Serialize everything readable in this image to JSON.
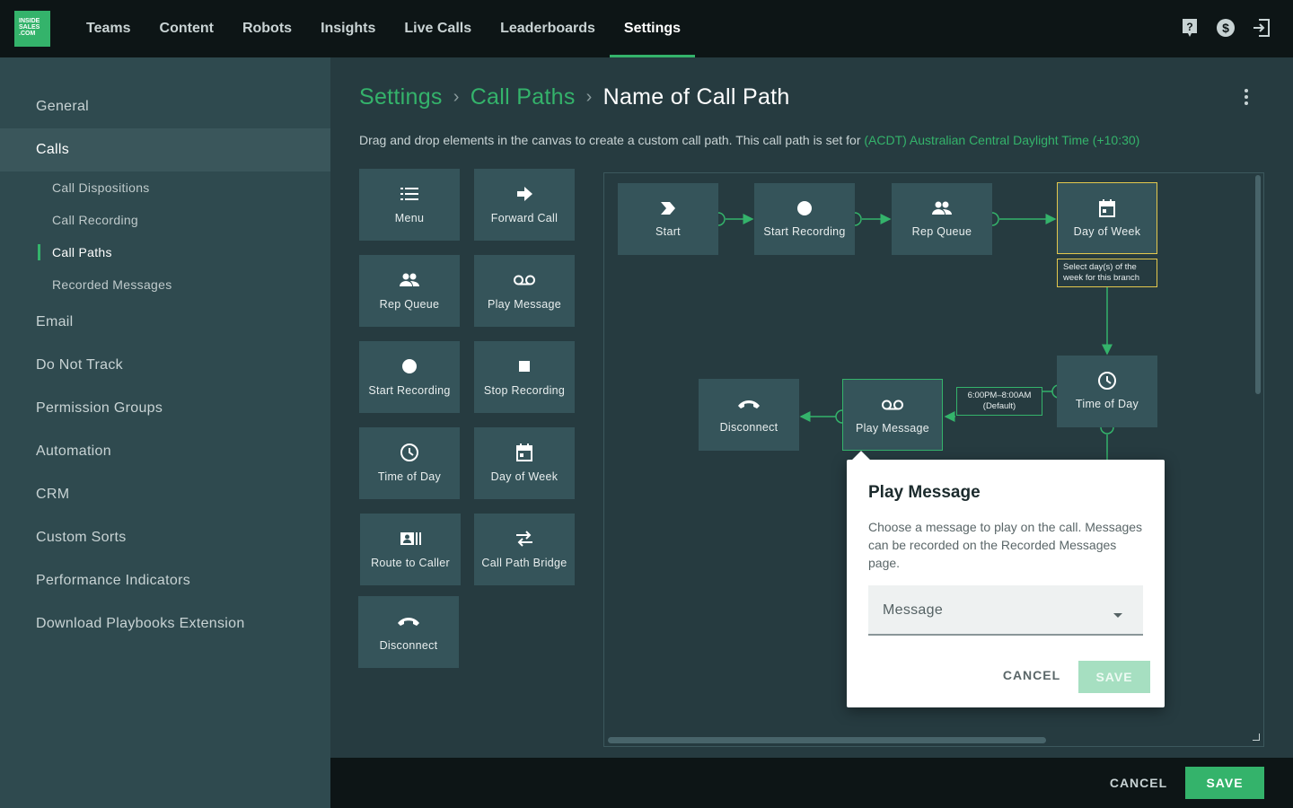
{
  "logo": {
    "line1": "INSIDE",
    "line2": "SALES",
    "line3": ".COM"
  },
  "nav": {
    "items": [
      "Teams",
      "Content",
      "Robots",
      "Insights",
      "Live Calls",
      "Leaderboards",
      "Settings"
    ],
    "active": "Settings"
  },
  "top_icons": [
    "help-icon",
    "dollar-icon",
    "logout-icon"
  ],
  "sidebar": {
    "general": "General",
    "calls": "Calls",
    "calls_sub": [
      "Call Dispositions",
      "Call Recording",
      "Call Paths",
      "Recorded Messages"
    ],
    "others": [
      "Email",
      "Do Not Track",
      "Permission Groups",
      "Automation",
      "CRM",
      "Custom Sorts",
      "Performance Indicators",
      "Download Playbooks Extension"
    ]
  },
  "breadcrumb": {
    "root": "Settings",
    "section": "Call Paths",
    "current": "Name of Call Path"
  },
  "description": {
    "text": "Drag and drop elements in the canvas to create a custom call path. This call path is set for ",
    "timezone": "(ACDT) Australian Central Daylight Time (+10:30)"
  },
  "palette": {
    "menu": "Menu",
    "forward_call": "Forward Call",
    "rep_queue": "Rep Queue",
    "play_message": "Play Message",
    "start_recording": "Start Recording",
    "stop_recording": "Stop Recording",
    "time_of_day": "Time of Day",
    "day_of_week": "Day of Week",
    "route_to_caller": "Route to Caller",
    "call_path_bridge": "Call Path Bridge",
    "disconnect": "Disconnect"
  },
  "canvas": {
    "nodes": {
      "start": "Start",
      "start_recording": "Start Recording",
      "rep_queue": "Rep Queue",
      "day_of_week": "Day of Week",
      "time_of_day": "Time of Day",
      "play_message": "Play Message",
      "disconnect": "Disconnect"
    },
    "day_tag": "Select day(s) of the week for this branch",
    "time_tag": {
      "range": "6:00PM–8:00AM",
      "default": "(Default)"
    }
  },
  "popup": {
    "title": "Play Message",
    "text": "Choose a message to play on the call. Messages can be recorded on the Recorded Messages page.",
    "select_placeholder": "Message",
    "cancel": "CANCEL",
    "save": "SAVE"
  },
  "footer": {
    "cancel": "CANCEL",
    "save": "SAVE"
  },
  "colors": {
    "accent": "#34b36b",
    "highlight": "#e4c84d",
    "panel": "#2f4a4f",
    "tile": "#35545a",
    "topbar": "#0d1516"
  }
}
